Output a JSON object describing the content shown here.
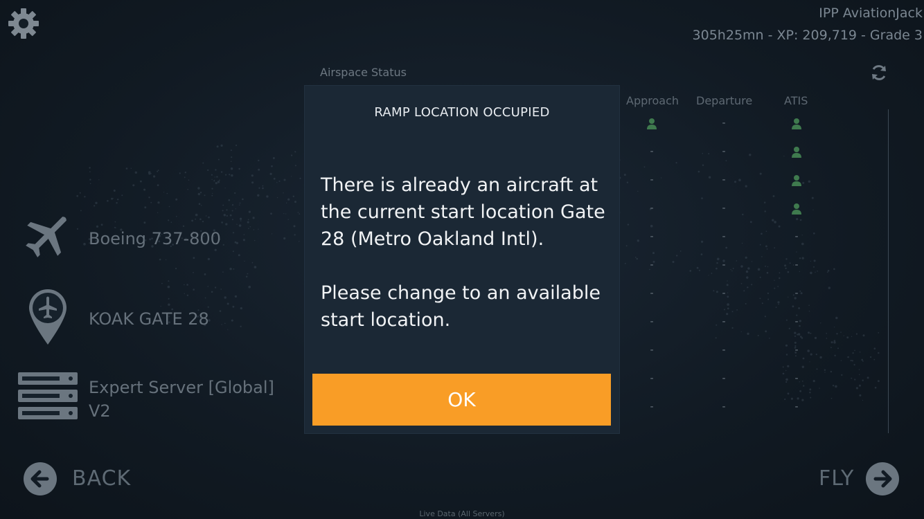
{
  "user": {
    "name": "IPP AviationJack",
    "stats": "305h25mn - XP: 209,719 - Grade 3"
  },
  "airspace": {
    "title": "Airspace Status",
    "columns": [
      "Approach",
      "Departure",
      "ATIS"
    ],
    "rows": [
      {
        "approach": "person",
        "departure": "-",
        "atis": "person"
      },
      {
        "approach": "-",
        "departure": "-",
        "atis": "person"
      },
      {
        "approach": "-",
        "departure": "-",
        "atis": "person"
      },
      {
        "approach": "-",
        "departure": "-",
        "atis": "person"
      },
      {
        "approach": "-",
        "departure": "-",
        "atis": "-"
      },
      {
        "approach": "-",
        "departure": "-",
        "atis": "-"
      },
      {
        "approach": "-",
        "departure": "-",
        "atis": "-"
      },
      {
        "approach": "-",
        "departure": "-",
        "atis": "-"
      },
      {
        "approach": "-",
        "departure": "-",
        "atis": "-"
      },
      {
        "approach": "-",
        "departure": "-",
        "atis": "-"
      },
      {
        "approach": "-",
        "departure": "-",
        "atis": "-"
      }
    ],
    "active_color": "#3f7a4e"
  },
  "flight": {
    "aircraft": "Boeing 737-800",
    "location": "KOAK GATE 28",
    "server_line1": "Expert Server [Global]",
    "server_line2": "V2"
  },
  "nav": {
    "back_label": "BACK",
    "fly_label": "FLY"
  },
  "footer_note": "Live Data (All Servers)",
  "modal": {
    "title": "RAMP LOCATION OCCUPIED",
    "paragraph1": "There is already an aircraft at the current start location Gate 28 (Metro Oakland Intl).",
    "paragraph2": "Please change to an available start location.",
    "ok_label": "OK",
    "ok_color": "#f99d26"
  },
  "icons": {
    "settings": "gear-icon",
    "refresh": "refresh-icon",
    "aircraft": "airplane-icon",
    "location": "map-pin-airplane-icon",
    "server": "server-icon",
    "back": "arrow-left-circle-icon",
    "fly": "arrow-right-circle-icon",
    "controller": "person-icon"
  }
}
